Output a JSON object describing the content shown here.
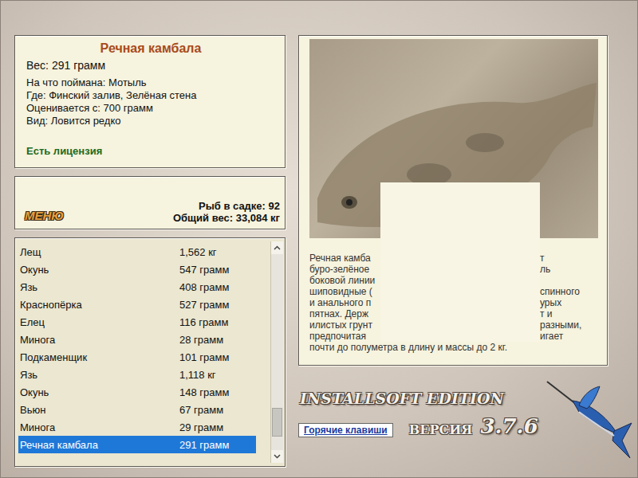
{
  "fish_card": {
    "title": "Речная камбала",
    "weight": "Вес: 291 грамм",
    "details": [
      "На что поймана: Мотыль",
      "Где: Финский залив, Зелёная стена",
      "Оценивается с: 700 грамм",
      "Вид: Ловится редко"
    ],
    "license": "Есть лицензия"
  },
  "keepnet": {
    "menu_button": "МЕНЮ",
    "count": "Рыб в садке: 92",
    "total": "Общий вес: 33,084 кг"
  },
  "catch_list": {
    "rows": [
      {
        "name": "Лещ",
        "weight": "1,562 кг",
        "selected": false
      },
      {
        "name": "Окунь",
        "weight": "547 грамм",
        "selected": false
      },
      {
        "name": "Язь",
        "weight": "408 грамм",
        "selected": false
      },
      {
        "name": "Краснопёрка",
        "weight": "527 грамм",
        "selected": false
      },
      {
        "name": "Елец",
        "weight": "116 грамм",
        "selected": false
      },
      {
        "name": "Минога",
        "weight": "28 грамм",
        "selected": false
      },
      {
        "name": "Подкаменщик",
        "weight": "101 грамм",
        "selected": false
      },
      {
        "name": "Язь",
        "weight": "1,118 кг",
        "selected": false
      },
      {
        "name": "Окунь",
        "weight": "148 грамм",
        "selected": false
      },
      {
        "name": "Вьюн",
        "weight": "67 грамм",
        "selected": false
      },
      {
        "name": "Минога",
        "weight": "29 грамм",
        "selected": false
      },
      {
        "name": "Речная камбала",
        "weight": "291 грамм",
        "selected": true
      }
    ],
    "scrollbar": {
      "level": 0.92
    }
  },
  "description": {
    "lines": [
      {
        "left": "Речная камба",
        "right": "т"
      },
      {
        "left": "буро-зелёное",
        "right": "ль"
      },
      {
        "left": "боковой линии",
        "right": ""
      },
      {
        "left": "шиповидные (",
        "right": "спинного"
      },
      {
        "left": "и анального п",
        "right": "урых"
      },
      {
        "left": "пятнах. Держ",
        "right": "т и"
      },
      {
        "left": "илистых грунт",
        "right": "разными,"
      },
      {
        "left": "предпочитая",
        "right": "игает"
      }
    ],
    "last_line": "почти до полуметра в длину и массы до 2 кг."
  },
  "hotkeys_button": "Горячие клавиши",
  "logo": {
    "title": "INSTALLSOFT EDITION",
    "version_label": "ВЕРСИЯ",
    "version": "3.7.6"
  }
}
